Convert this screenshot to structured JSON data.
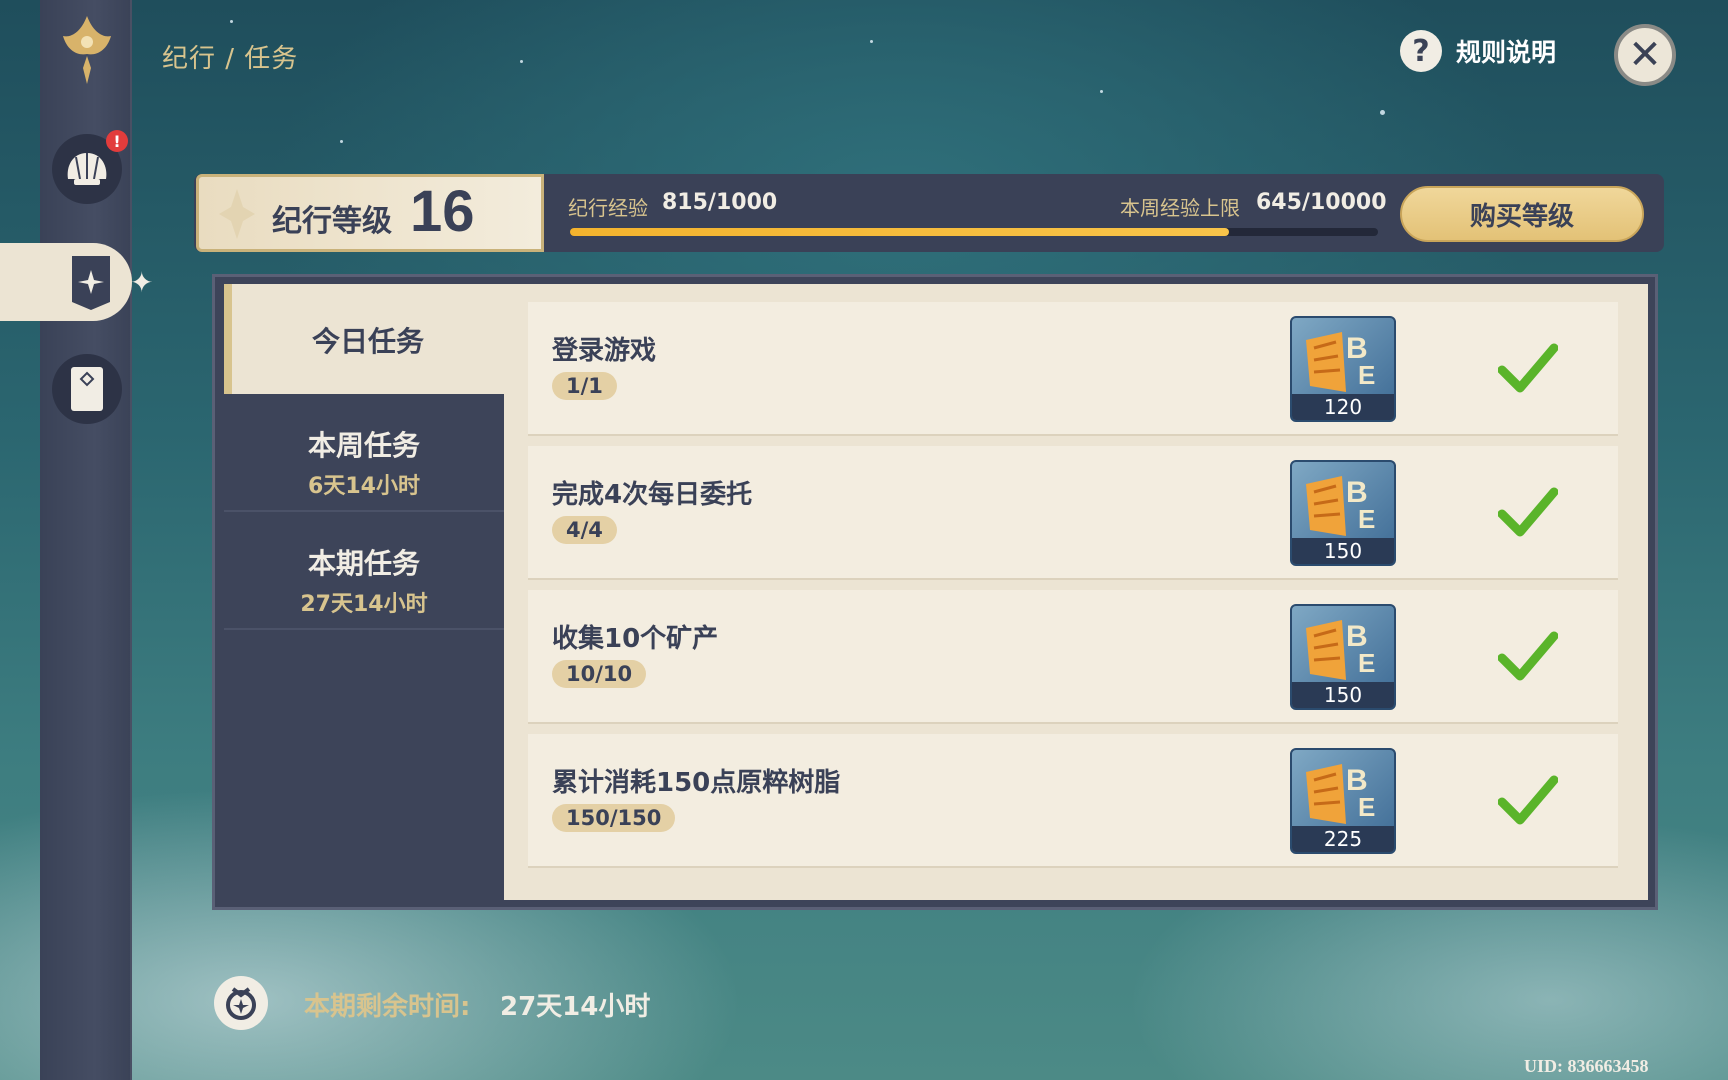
{
  "breadcrumb": "纪行 / 任务",
  "help": {
    "icon": "?",
    "label": "规则说明"
  },
  "close": {
    "icon": "✕"
  },
  "sidebar": {
    "notification_badge": "!",
    "items": [
      {
        "name": "emblem-icon"
      },
      {
        "name": "shell-icon"
      },
      {
        "name": "banner-icon"
      },
      {
        "name": "card-icon"
      }
    ]
  },
  "level": {
    "label": "纪行等级",
    "value": "16"
  },
  "experience": {
    "label": "纪行经验",
    "value": "815/1000",
    "progress": 0.815
  },
  "weekly_cap": {
    "label": "本周经验上限",
    "value": "645/10000"
  },
  "buy_button": "购买等级",
  "tabs": [
    {
      "title": "今日任务",
      "sub": ""
    },
    {
      "title": "本周任务",
      "sub": "6天14小时"
    },
    {
      "title": "本期任务",
      "sub": "27天14小时"
    }
  ],
  "tasks": [
    {
      "title": "登录游戏",
      "progress": "1/1",
      "reward": "120",
      "completed": true
    },
    {
      "title": "完成4次每日委托",
      "progress": "4/4",
      "reward": "150",
      "completed": true
    },
    {
      "title": "收集10个矿产",
      "progress": "10/10",
      "reward": "150",
      "completed": true
    },
    {
      "title": "累计消耗150点原粹树脂",
      "progress": "150/150",
      "reward": "225",
      "completed": true
    }
  ],
  "footer": {
    "label": "本期剩余时间:",
    "value": "27天14小时"
  },
  "uid": "UID: 836663458",
  "colors": {
    "accent_gold": "#d8c48e",
    "panel_dark": "#3a4157",
    "check_green": "#5ab42a",
    "exp_bar": "#f3b32e"
  }
}
